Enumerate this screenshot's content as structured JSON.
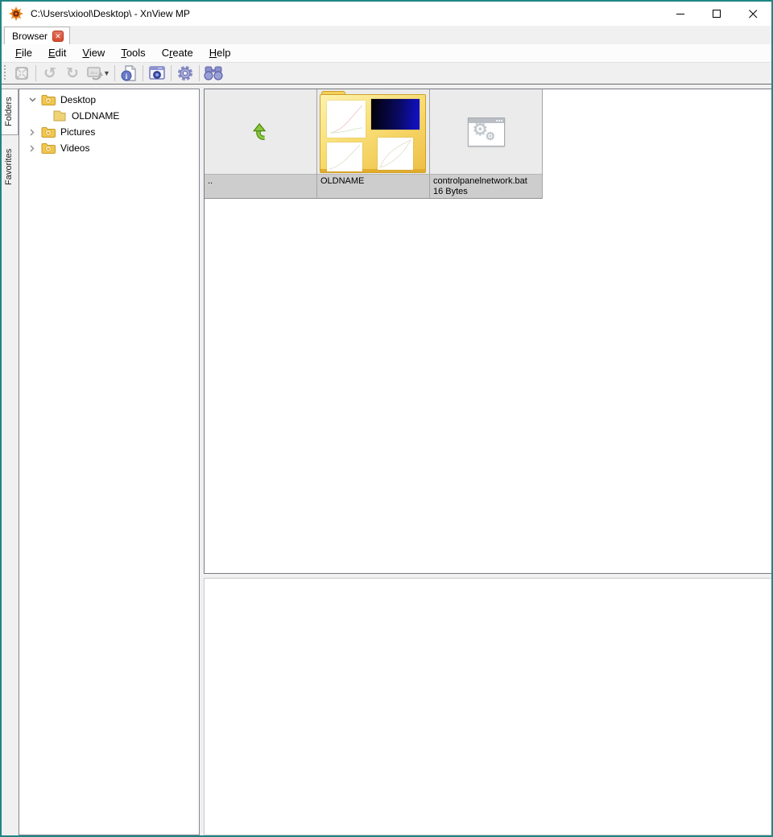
{
  "window": {
    "title": "C:\\Users\\xiool\\Desktop\\ - XnView MP"
  },
  "tabbar": {
    "tab_label": "Browser"
  },
  "menubar": {
    "items": [
      {
        "pre": "",
        "u": "F",
        "post": "ile"
      },
      {
        "pre": "",
        "u": "E",
        "post": "dit"
      },
      {
        "pre": "",
        "u": "V",
        "post": "iew"
      },
      {
        "pre": "",
        "u": "T",
        "post": "ools"
      },
      {
        "pre": "C",
        "u": "r",
        "post": "eate"
      },
      {
        "pre": "",
        "u": "H",
        "post": "elp"
      }
    ]
  },
  "toolbar": {
    "buttons": [
      "fullscreen",
      "rotate-left",
      "rotate-right",
      "convert-export",
      "file-info",
      "capture",
      "settings",
      "search"
    ]
  },
  "sidebar": {
    "tabs": [
      {
        "label": "Folders",
        "active": true
      },
      {
        "label": "Favorites",
        "active": false
      }
    ]
  },
  "tree": {
    "items": [
      {
        "label": "Desktop",
        "expanded": true,
        "icon": "special-folder"
      },
      {
        "label": "OLDNAME",
        "icon": "plain-folder"
      },
      {
        "label": "Pictures",
        "expanded": false,
        "icon": "special-folder"
      },
      {
        "label": "Videos",
        "expanded": false,
        "icon": "special-folder"
      }
    ]
  },
  "browser": {
    "items": [
      {
        "label": "..",
        "type": "parent-directory"
      },
      {
        "label": "OLDNAME",
        "type": "folder"
      },
      {
        "label": "controlpanelnetwork.bat",
        "size": "16 Bytes",
        "type": "bat-file"
      }
    ]
  },
  "colors": {
    "accent_teal": "#1f8583",
    "tab_close_red": "#d74a2e",
    "folder_yellow": "#f0c243",
    "up_arrow_green": "#6ab121",
    "toolbar_icon_blue": "#8a8ec6"
  }
}
